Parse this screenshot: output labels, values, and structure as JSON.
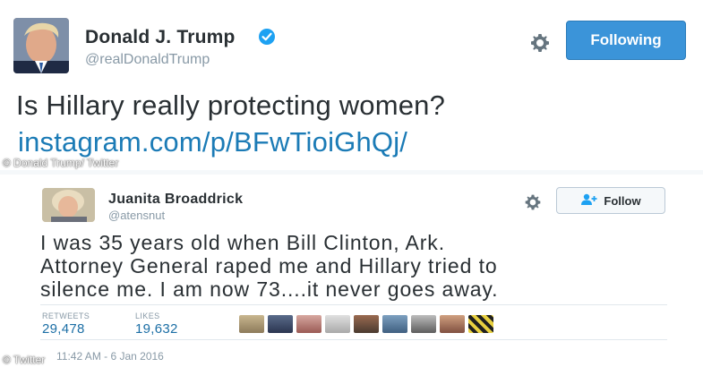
{
  "tweet1": {
    "display_name": "Donald J. Trump",
    "handle": "@realDonaldTrump",
    "follow_label": "Following",
    "text": "Is Hillary really protecting women?",
    "link": "instagram.com/p/BFwTioiGhQj/",
    "photo_credit": "© Donald Trump/ Twitter",
    "icons": {
      "verified": "verified-badge-icon",
      "settings": "gear-icon",
      "avatar": "profile-photo"
    },
    "colors": {
      "button": "#3b94d9",
      "link": "#1b7bb6"
    }
  },
  "tweet2": {
    "display_name": "Juanita Broaddrick",
    "handle": "@atensnut",
    "follow_label": "Follow",
    "text_lines": [
      "I was 35 years old when Bill Clinton, Ark.",
      "Attorney General raped me and Hillary tried to",
      "silence me.  I am now 73....it never goes away."
    ],
    "retweets_label": "RETWEETS",
    "retweets_value": "29,478",
    "likes_label": "LIKES",
    "likes_value": "19,632",
    "timestamp": "11:42 AM - 6 Jan 2016",
    "photo_credit": "© Twitter",
    "liker_avatars": [
      "liker-avatar-1",
      "liker-avatar-2",
      "liker-avatar-3",
      "liker-avatar-4",
      "liker-avatar-5",
      "liker-avatar-6",
      "liker-avatar-7",
      "liker-avatar-8",
      "liker-avatar-9"
    ],
    "icons": {
      "settings": "gear-icon",
      "follow": "add-user-icon"
    }
  }
}
